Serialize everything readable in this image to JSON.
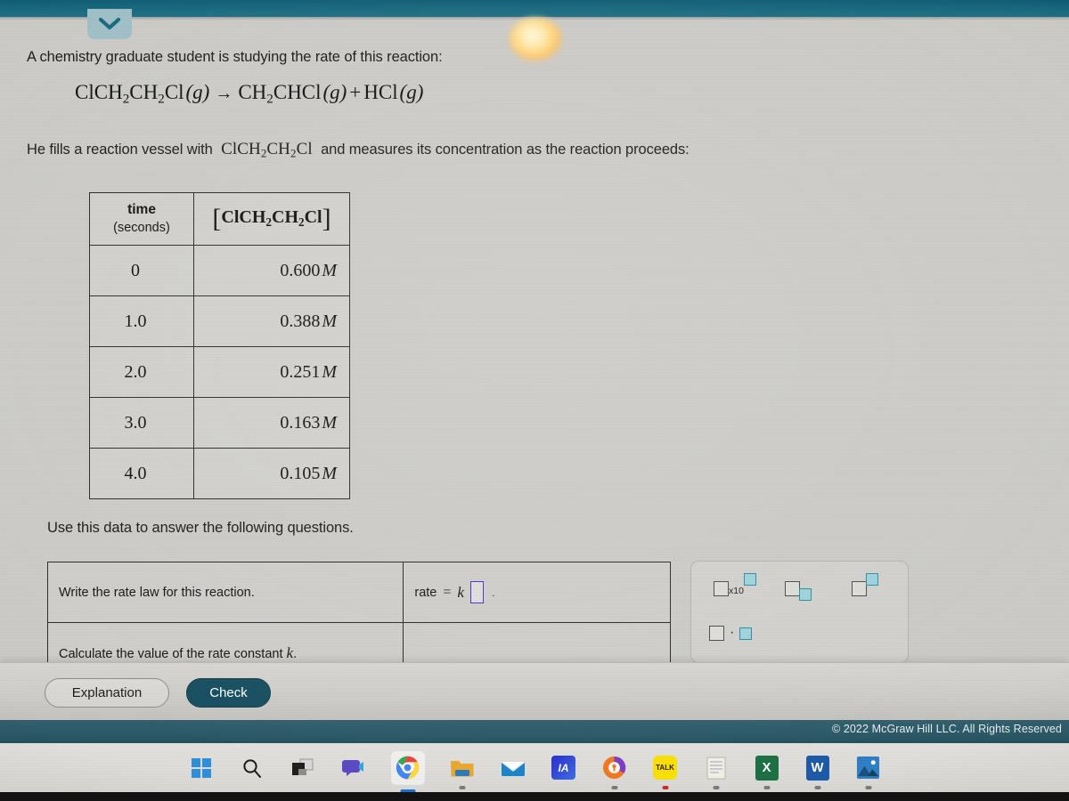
{
  "app": {
    "chevron_icon": "chevron-down-icon",
    "topbar_color": "#16687e",
    "footer_color": "#2b5867",
    "accent_color": "#184f60",
    "answer_box_color": "#4436c8"
  },
  "problem": {
    "intro": "A chemistry graduate student is studying the rate of this reaction:",
    "equation": {
      "reactant": "ClCH₂CH₂Cl",
      "reactant_state": "(g)",
      "arrow": "→",
      "product1": "CH₂CHCl",
      "product1_state": "(g)",
      "plus": "+",
      "product2": "HCl",
      "product2_state": "(g)",
      "full_text": "ClCH2CH2Cl (g) → CH2CHCl (g) + HCl (g)"
    },
    "setup_prefix": "He fills a reaction vessel with",
    "setup_species": "ClCH₂CH₂Cl",
    "setup_suffix": "and measures its concentration as the reaction proceeds:",
    "use_data_line": "Use this data to answer the following questions."
  },
  "data_table": {
    "headers": {
      "time_main": "time",
      "time_sub": "(seconds)",
      "conc": "[ClCH₂CH₂Cl]"
    },
    "rows": [
      {
        "time": "0",
        "conc": "0.600",
        "unit": "M"
      },
      {
        "time": "1.0",
        "conc": "0.388",
        "unit": "M"
      },
      {
        "time": "2.0",
        "conc": "0.251",
        "unit": "M"
      },
      {
        "time": "3.0",
        "conc": "0.163",
        "unit": "M"
      },
      {
        "time": "4.0",
        "conc": "0.105",
        "unit": "M"
      }
    ]
  },
  "chart_data": {
    "type": "table",
    "title": "[ClCH2CH2Cl] vs time",
    "xlabel": "time (seconds)",
    "ylabel": "[ClCH2CH2Cl] (M)",
    "x": [
      0,
      1.0,
      2.0,
      3.0,
      4.0
    ],
    "y": [
      0.6,
      0.388,
      0.251,
      0.163,
      0.105
    ],
    "categories": [
      "0",
      "1.0",
      "2.0",
      "3.0",
      "4.0"
    ],
    "values": [
      0.6,
      0.388,
      0.251,
      0.163,
      0.105
    ],
    "units": "M",
    "series": [
      {
        "name": "[ClCH2CH2Cl]",
        "values": [
          0.6,
          0.388,
          0.251,
          0.163,
          0.105
        ]
      }
    ]
  },
  "questions": [
    {
      "prompt": "Write the rate law for this reaction.",
      "answer_prefix": "rate",
      "answer_equals": "=",
      "answer_k": "k",
      "answer_value": "",
      "answer_trailing": "."
    },
    {
      "prompt_prefix": "Calculate the value of the rate constant",
      "prompt_symbol": "k",
      "prompt_suffix": ".",
      "answer_value": ""
    }
  ],
  "palette": {
    "buttons": [
      {
        "name": "scientific-notation",
        "label": "x10"
      },
      {
        "name": "subscript",
        "label": ""
      },
      {
        "name": "superscript",
        "label": ""
      },
      {
        "name": "multiplication",
        "label": "·"
      }
    ]
  },
  "footer": {
    "explanation_label": "Explanation",
    "check_label": "Check",
    "copyright": "© 2022 McGraw Hill LLC. All Rights Reserved"
  },
  "taskbar": {
    "items": [
      {
        "name": "start-icon",
        "glyph": "windows"
      },
      {
        "name": "search-icon",
        "glyph": "search"
      },
      {
        "name": "task-view-icon",
        "glyph": "taskview"
      },
      {
        "name": "chat-icon",
        "glyph": "chat"
      },
      {
        "name": "chrome-icon",
        "glyph": "chrome"
      },
      {
        "name": "file-explorer-icon",
        "glyph": "folder"
      },
      {
        "name": "mail-icon",
        "glyph": "mail"
      },
      {
        "name": "ia-app-icon",
        "glyph": "IA"
      },
      {
        "name": "avast-icon",
        "glyph": "avast"
      },
      {
        "name": "kakaotalk-icon",
        "glyph": "TALK"
      },
      {
        "name": "notepad-icon",
        "glyph": "notepad"
      },
      {
        "name": "excel-icon",
        "glyph": "X"
      },
      {
        "name": "word-icon",
        "glyph": "W"
      },
      {
        "name": "photos-icon",
        "glyph": "photos"
      }
    ]
  }
}
